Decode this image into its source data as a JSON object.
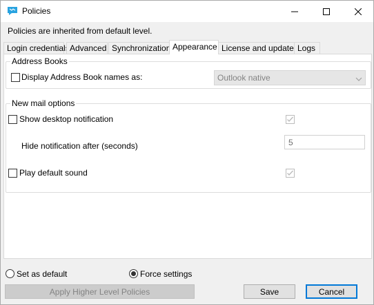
{
  "window": {
    "title": "Policies",
    "icon": "chat-bubble-icon",
    "accent": "#0078d7"
  },
  "inherit_notice": "Policies are inherited from default level.",
  "tabs": [
    {
      "label": "Login credentials",
      "active": false
    },
    {
      "label": "Advanced",
      "active": false
    },
    {
      "label": "Synchronization",
      "active": false
    },
    {
      "label": "Appearance",
      "active": true
    },
    {
      "label": "License and updates",
      "active": false
    },
    {
      "label": "Logs",
      "active": false
    }
  ],
  "address_books": {
    "group_label": "Address Books",
    "display_names_label": "Display Address Book names as:",
    "display_names_checked": false,
    "display_names_value": "Outlook native"
  },
  "new_mail": {
    "group_label": "New mail options",
    "show_notification_label": "Show desktop notification",
    "show_notification_checked": false,
    "hide_after_label": "Hide notification after (seconds)",
    "hide_after_value": "5",
    "play_sound_label": "Play default sound",
    "play_sound_checked": false
  },
  "footer": {
    "set_default_label": "Set as default",
    "force_settings_label": "Force settings",
    "selected_mode": "force",
    "apply_higher_label": "Apply Higher Level Policies",
    "save_label": "Save",
    "cancel_label": "Cancel"
  }
}
